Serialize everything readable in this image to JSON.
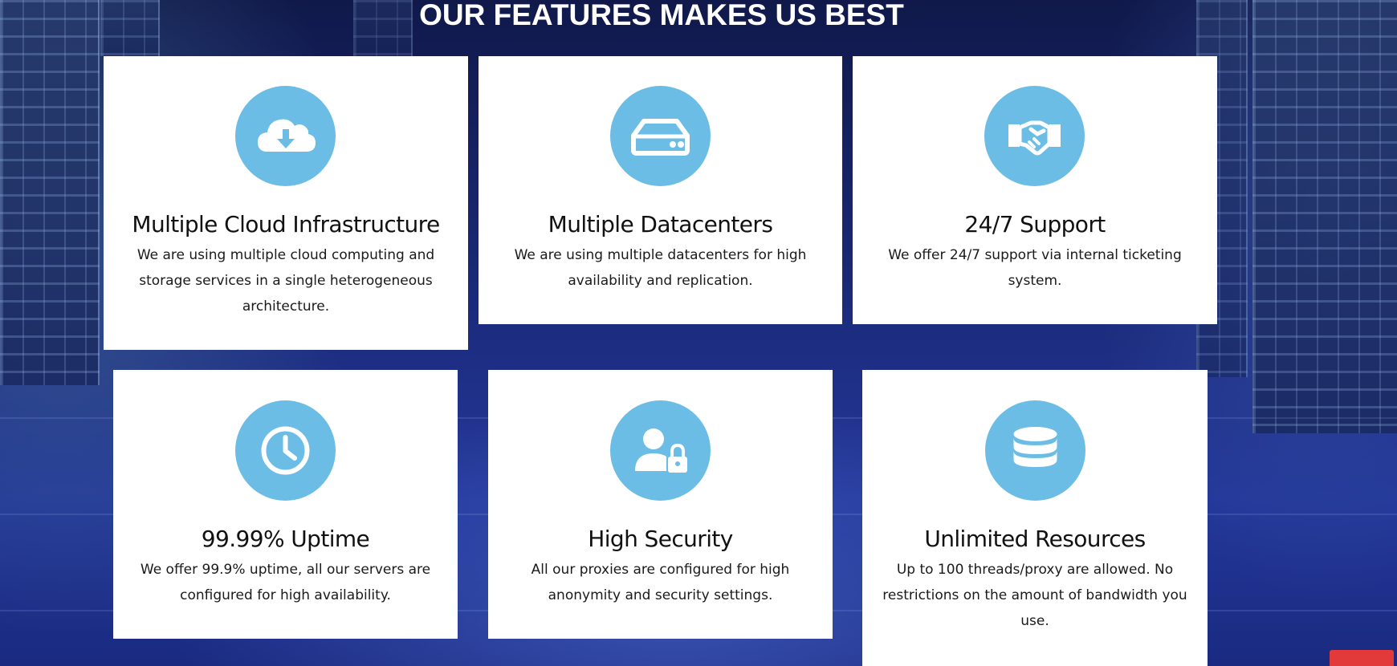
{
  "section": {
    "title": "OUR FEATURES MAKES US BEST"
  },
  "colors": {
    "icon_circle": "#6cbde6",
    "card_bg": "#ffffff",
    "accent_button": "#e23a3a"
  },
  "features": [
    {
      "icon": "cloud-download-icon",
      "title": "Multiple Cloud Infrastructure",
      "description": "We are using multiple cloud computing and storage services in a single heterogeneous architecture."
    },
    {
      "icon": "hard-drive-icon",
      "title": "Multiple Datacenters",
      "description": "We are using multiple datacenters for high availability and replication."
    },
    {
      "icon": "handshake-icon",
      "title": "24/7 Support",
      "description": "We offer 24/7 support via internal ticketing system."
    },
    {
      "icon": "clock-icon",
      "title": "99.99% Uptime",
      "description": "We offer 99.9% uptime, all our servers are configured for high availability."
    },
    {
      "icon": "user-lock-icon",
      "title": "High Security",
      "description": "All our proxies are configured for high anonymity and security settings."
    },
    {
      "icon": "database-icon",
      "title": "Unlimited Resources",
      "description": "Up to 100 threads/proxy are allowed. No restrictions on the amount of bandwidth you use."
    }
  ]
}
